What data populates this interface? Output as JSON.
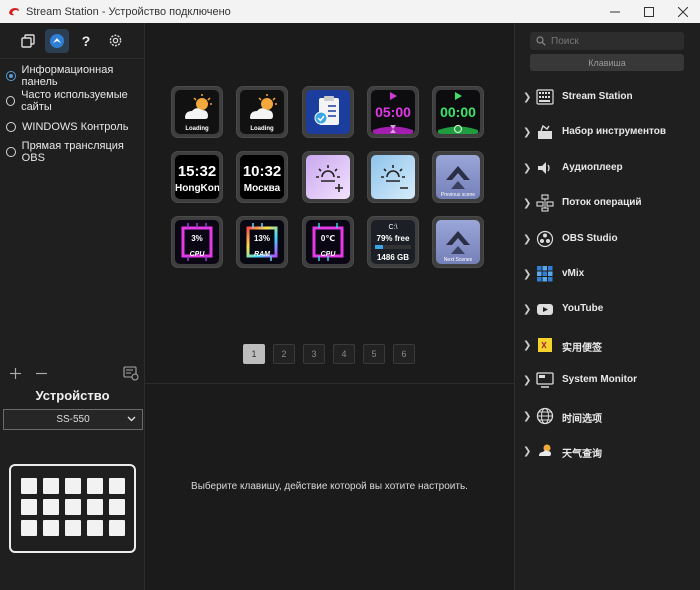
{
  "window": {
    "title": "Stream Station - Устройство подключено"
  },
  "toolbar": {
    "icons": [
      "layers-icon",
      "logo-icon",
      "help-icon",
      "settings-icon"
    ],
    "help_glyph": "?"
  },
  "profiles": [
    {
      "label": "Информационная панель",
      "selected": true
    },
    {
      "label": "Часто используемые сайты",
      "selected": false
    },
    {
      "label": "WINDOWS Контроль",
      "selected": false
    },
    {
      "label": "Прямая трансляция OBS",
      "selected": false
    }
  ],
  "device": {
    "title": "Устройство",
    "model": "SS-550",
    "keys_rows": 3,
    "keys_cols": 5
  },
  "keys": [
    {
      "name": "weather-key",
      "caption": "Loading"
    },
    {
      "name": "weather-key-2",
      "caption": "Loading"
    },
    {
      "name": "clipboard-key",
      "caption": ""
    },
    {
      "name": "countdown-key",
      "main": "05:00"
    },
    {
      "name": "timer-key",
      "main": "00:00"
    },
    {
      "name": "clock-hongkong-key",
      "main": "15:32",
      "sub": "HongKong"
    },
    {
      "name": "clock-moscow-key",
      "main": "10:32",
      "sub": "Москва"
    },
    {
      "name": "brightness-up-key",
      "main": "+"
    },
    {
      "name": "brightness-down-key",
      "main": "−"
    },
    {
      "name": "previous-scene-key",
      "caption": "Previous scene"
    },
    {
      "name": "cpu-usage-key",
      "main": "3%",
      "sub": "CPU"
    },
    {
      "name": "ram-usage-key",
      "main": "13%",
      "sub": "RAM"
    },
    {
      "name": "cpu-temp-key",
      "main": "0℃",
      "sub": "CPU"
    },
    {
      "name": "disk-key",
      "drive": "C:\\",
      "main": "79% free",
      "sub": "1486 GB"
    },
    {
      "name": "next-scene-key",
      "caption": "Next Scenes"
    }
  ],
  "pages": {
    "items": [
      "1",
      "2",
      "3",
      "4",
      "5",
      "6"
    ],
    "active": 0
  },
  "hint": "Выберите клавишу, действие которой вы хотите настроить.",
  "search": {
    "placeholder": "Поиск"
  },
  "tabs": {
    "key_label": "Клавиша"
  },
  "plugins": [
    {
      "label": "Stream Station",
      "icon": "keyboard-icon"
    },
    {
      "label": "Набор инструментов",
      "icon": "toolbox-icon"
    },
    {
      "label": "Аудиоплеер",
      "icon": "speaker-icon"
    },
    {
      "label": "Поток операций",
      "icon": "workflow-icon"
    },
    {
      "label": "OBS Studio",
      "icon": "obs-icon"
    },
    {
      "label": "vMix",
      "icon": "vmix-icon"
    },
    {
      "label": "YouTube",
      "icon": "youtube-icon"
    },
    {
      "label": "实用便签",
      "icon": "sticky-note-icon"
    },
    {
      "label": "System Monitor",
      "icon": "monitor-icon"
    },
    {
      "label": "时间选项",
      "icon": "globe-icon"
    },
    {
      "label": "天气查询",
      "icon": "weather-icon"
    }
  ],
  "colors": {
    "accent": "#5b9bd5",
    "panel": "#1f1f1f",
    "background": "#1b1b1b"
  }
}
